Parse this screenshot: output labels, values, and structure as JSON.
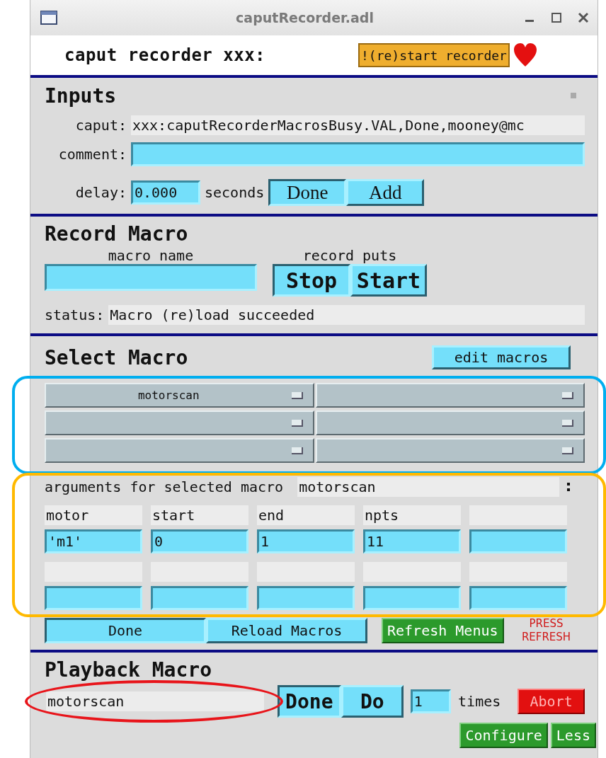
{
  "window": {
    "title": "caputRecorder.adl"
  },
  "header": {
    "title": "caput recorder xxx:",
    "restart_button": "!(re)start recorder"
  },
  "inputs": {
    "heading": "Inputs",
    "caput_label": "caput:",
    "caput_value": "xxx:caputRecorderMacrosBusy.VAL,Done,mooney@mc",
    "comment_label": "comment:",
    "delay_label": "delay:",
    "delay_value": "0.000",
    "delay_unit": "seconds",
    "choices": [
      {
        "label": "Done",
        "selected": true
      },
      {
        "label": "Add",
        "selected": false
      }
    ]
  },
  "record": {
    "heading": "Record Macro",
    "macro_name_label": "macro name",
    "record_puts_label": "record puts",
    "choices": [
      {
        "label": "Stop",
        "selected": true
      },
      {
        "label": "Start",
        "selected": false
      }
    ],
    "status_label": "status:",
    "status_value": "Macro (re)load succeeded"
  },
  "select": {
    "heading": "Select Macro",
    "edit_button": "edit macros",
    "menus": [
      {
        "kind": "menu",
        "label": "motorscan"
      },
      {
        "kind": "menu"
      },
      {
        "kind": "menu"
      },
      {
        "kind": "menu"
      },
      {
        "kind": "menu"
      },
      {
        "kind": "menu"
      }
    ]
  },
  "arguments": {
    "label": "arguments for selected macro",
    "macro": "motorscan",
    "slots": [
      {
        "kind": "arg",
        "name": "motor",
        "value": "'m1'"
      },
      {
        "kind": "arg",
        "name": "start",
        "value": "0"
      },
      {
        "kind": "arg",
        "name": "end",
        "value": "1"
      },
      {
        "kind": "arg",
        "name": "npts",
        "value": "11"
      },
      {
        "kind": "arg"
      },
      {
        "kind": "arg"
      },
      {
        "kind": "arg"
      },
      {
        "kind": "arg"
      },
      {
        "kind": "arg"
      },
      {
        "kind": "arg"
      }
    ]
  },
  "controls": {
    "choices": [
      {
        "label": "Done",
        "selected": true
      },
      {
        "label": "Reload Macros",
        "selected": false
      }
    ],
    "refresh_button": "Refresh Menus",
    "warning": "PRESS REFRESH"
  },
  "playback": {
    "heading": "Playback Macro",
    "macro": "motorscan",
    "choices": [
      {
        "label": "Done",
        "selected": true
      },
      {
        "label": "Do",
        "selected": false
      }
    ],
    "times_value": "1",
    "times_label": "times",
    "abort_button": "Abort",
    "configure_button": "Configure",
    "less_button": "Less"
  },
  "annotations": [
    {
      "kind": "rounded-rect",
      "color": "#00aeef"
    },
    {
      "kind": "rounded-rect",
      "color": "#ffb900"
    },
    {
      "kind": "ellipse",
      "color": "#e8141a"
    }
  ]
}
